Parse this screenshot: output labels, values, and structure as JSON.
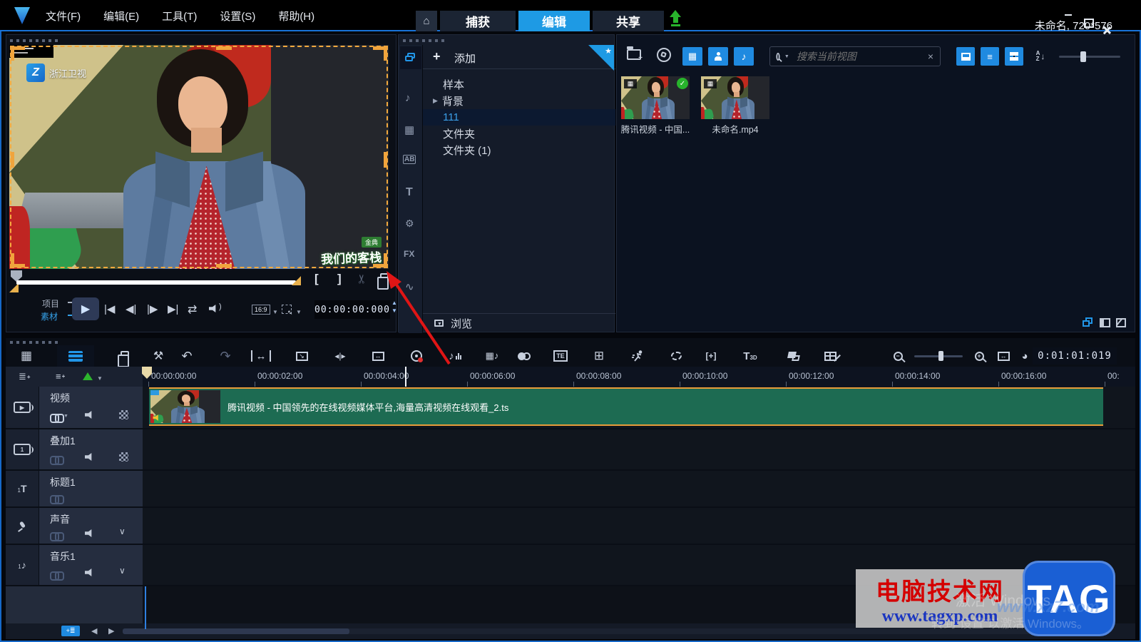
{
  "window": {
    "menus": [
      "文件(F)",
      "编辑(E)",
      "工具(T)",
      "设置(S)",
      "帮助(H)"
    ],
    "tabs": [
      {
        "label": "捕获"
      },
      {
        "label": "编辑"
      },
      {
        "label": "共享"
      }
    ],
    "project_info": "未命名, 720*576"
  },
  "preview": {
    "tv_logo": "浙江卫视",
    "tv_logo_letter": "Z",
    "brand_badge": "金典",
    "show_badge": "我们的客栈",
    "project_toggle": "项目",
    "clip_toggle": "素材",
    "aspect_ratio": "16:9",
    "timecode": "00:00:00:000"
  },
  "library": {
    "add_label": "添加",
    "browse_label": "浏览",
    "rail": {
      "ab": "AB",
      "title": "T",
      "fx": "FX"
    },
    "folders": [
      {
        "label": "样本"
      },
      {
        "label": "背景"
      },
      {
        "label": "111"
      },
      {
        "label": "文件夹"
      },
      {
        "label": "文件夹 (1)"
      }
    ]
  },
  "media": {
    "search_placeholder": "搜索当前视图",
    "items": [
      {
        "label": "腾讯视频 - 中国..."
      },
      {
        "label": "未命名.mp4"
      }
    ]
  },
  "timeline": {
    "duration": "0:01:01:019",
    "ruler": [
      "00:00:00:00",
      "00:00:02:00",
      "00:00:04:00",
      "00:00:06:00",
      "00:00:08:00",
      "00:00:10:00",
      "00:00:12:00",
      "00:00:14:00",
      "00:00:16:00",
      "00:"
    ],
    "tracks": [
      {
        "name": "视频"
      },
      {
        "name": "叠加1"
      },
      {
        "name": "标题1"
      },
      {
        "name": "声音"
      },
      {
        "name": "音乐1"
      }
    ],
    "clip_label": "腾讯视频 - 中国领先的在线视频媒体平台,海量高清视频在线观看_2.ts",
    "icons": {
      "t3d": "T3D",
      "te": "TE"
    }
  },
  "watermark": {
    "site_name": "电脑技术网",
    "site_url": "www.tagxp.com",
    "logo_text": "TAG",
    "faint_url": "www.xz7.com",
    "activate_title": "激活 Windows",
    "activate_subtitle": "转到“设置”以激活 Windows。"
  },
  "colors": {
    "accent_blue": "#1e9ae4",
    "selection_orange": "#f0a43c",
    "clip_green": "#1d6b52",
    "arrow_red": "#e01515"
  }
}
